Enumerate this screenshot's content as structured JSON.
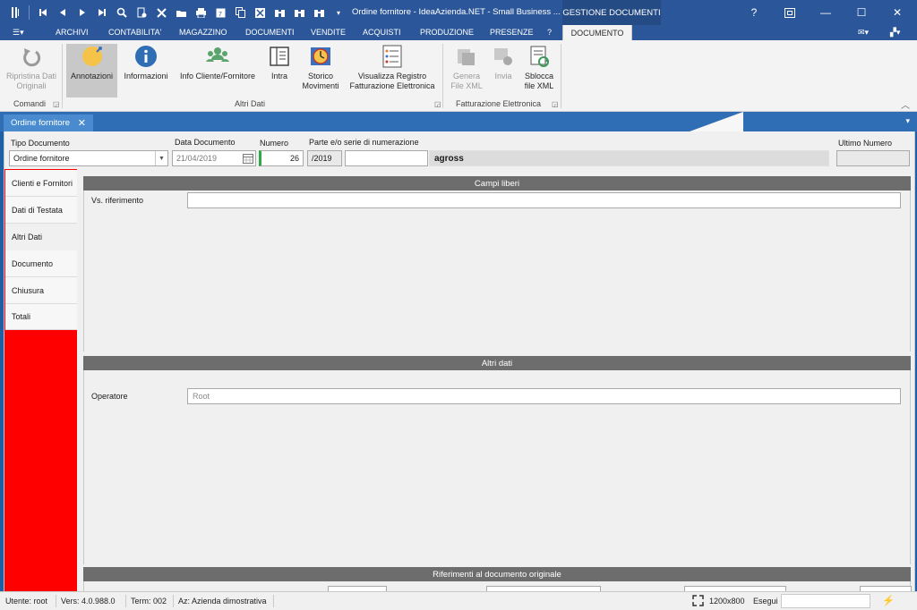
{
  "titlebar": {
    "title": "Ordine fornitore - IdeaAzienda.NET - Small Business ...",
    "context_group": "GESTIONE DOCUMENTI",
    "help": "?",
    "restore_icon": "restore-window-icon",
    "minimize": "—",
    "maximize": "☐",
    "close": "✕"
  },
  "menu": {
    "app_icon": "☰▾",
    "items": [
      "ARCHIVI",
      "CONTABILITA'",
      "MAGAZZINO",
      "DOCUMENTI",
      "VENDITE",
      "ACQUISTI",
      "PRODUZIONE",
      "PRESENZE",
      "?"
    ],
    "active_tab": "DOCUMENTO",
    "mail": "✉▾",
    "layout": "▞▾"
  },
  "ribbon": {
    "comandi": {
      "ripristina": "Ripristina Dati Originali",
      "label": "Comandi"
    },
    "altri_dati": {
      "annotazioni": "Annotazioni",
      "informazioni": "Informazioni",
      "info_cliente": "Info Cliente/Fornitore",
      "intra": "Intra",
      "storico": "Storico Movimenti",
      "registro": "Visualizza Registro Fatturazione Elettronica",
      "label": "Altri Dati"
    },
    "fatturazione": {
      "genera": "Genera File XML",
      "invia": "Invia",
      "sblocca": "Sblocca file XML",
      "label": "Fatturazione Elettronica"
    },
    "collapse": "︿"
  },
  "doc_tab": {
    "label": "Ordine fornitore",
    "close": "✕",
    "dropdown": "▾"
  },
  "header": {
    "tipo_documento_label": "Tipo Documento",
    "tipo_documento_value": "Ordine fornitore",
    "data_label": "Data Documento",
    "data_value": "21/04/2019",
    "numero_label": "Numero",
    "numero_value": "26",
    "serie_label": "Parte e/o serie di numerazione",
    "serie_prefix": "/2019",
    "serie_value": "",
    "agross": "agross",
    "ultimo_label": "Ultimo Numero",
    "ultimo_value": ""
  },
  "sidebar": {
    "items": [
      "Clienti e Fornitori",
      "Dati di Testata",
      "Altri Dati",
      "Documento",
      "Chiusura",
      "Totali"
    ],
    "active": "Altri Dati"
  },
  "panels": {
    "campi_liberi": {
      "title": "Campi liberi",
      "vs_riferimento_label": "Vs. riferimento",
      "vs_riferimento_value": ""
    },
    "altri_dati": {
      "title": "Altri dati",
      "operatore_label": "Operatore",
      "operatore_value": "Root"
    },
    "riferimenti": {
      "title": "Riferimenti al documento originale"
    }
  },
  "status": {
    "utente": "Utente: root",
    "versione": "Vers: 4.0.988.0",
    "terminale": "Term: 002",
    "azienda": "Az: Azienda dimostrativa",
    "resolution": "1200x800",
    "esegui": "Esegui",
    "bolt": "⚡"
  },
  "colors": {
    "title_bar": "#2b579a",
    "sidebar_accent": "#ff0000",
    "panel_header": "#6d6d6d"
  }
}
